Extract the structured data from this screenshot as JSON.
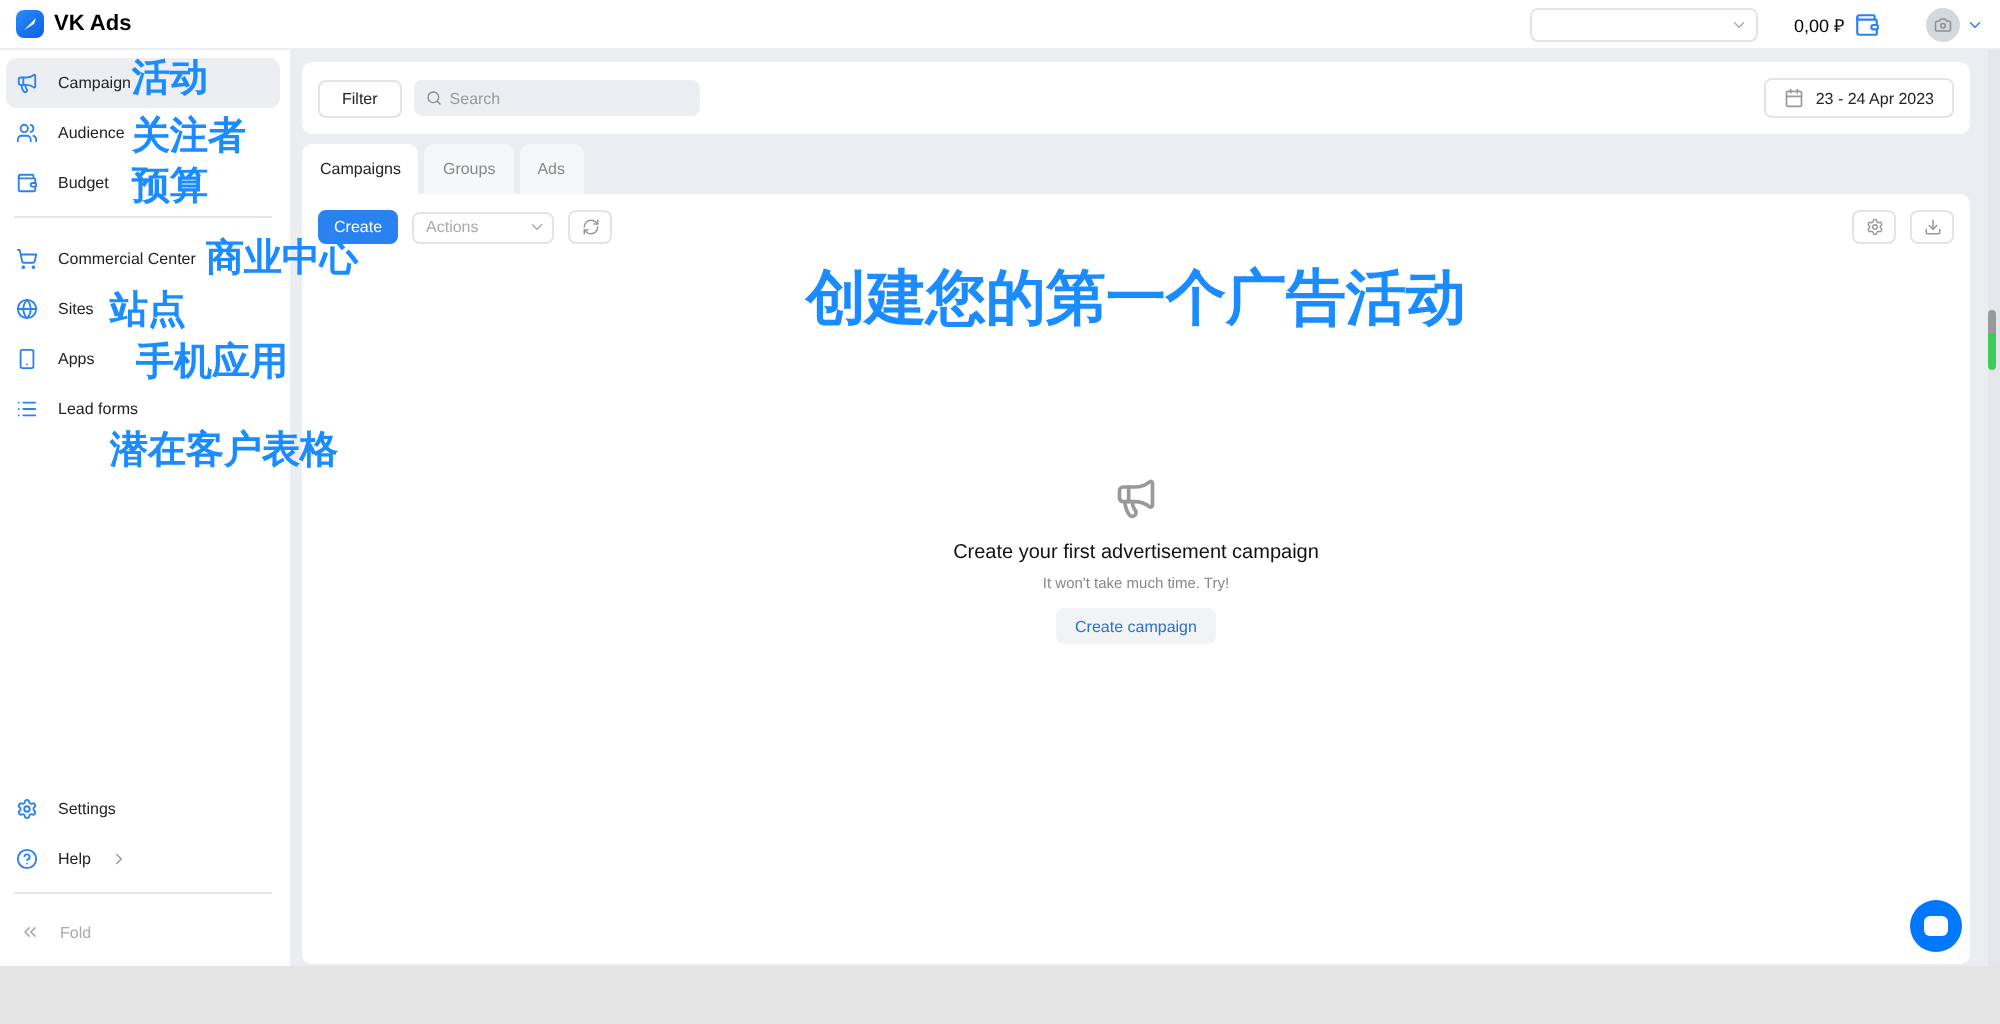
{
  "app": {
    "title": "VK Ads"
  },
  "topbar": {
    "balance": "0,00 ₽"
  },
  "sidebar": {
    "items": [
      {
        "label": "Campaign",
        "selected": true,
        "annotation": "活动"
      },
      {
        "label": "Audience",
        "selected": false,
        "annotation": "关注者"
      },
      {
        "label": "Budget",
        "selected": false,
        "annotation": "预算"
      },
      {
        "kind": "divider"
      },
      {
        "label": "Commercial Center",
        "selected": false,
        "annotation": "商业中心"
      },
      {
        "label": "Sites",
        "selected": false,
        "annotation": "站点"
      },
      {
        "label": "Apps",
        "selected": false,
        "annotation": "手机应用"
      },
      {
        "label": "Lead forms",
        "selected": false,
        "annotation": "潜在客户表格"
      }
    ],
    "bottom": [
      {
        "label": "Settings"
      },
      {
        "label": "Help"
      }
    ],
    "fold": "Fold"
  },
  "filters": {
    "filter_button": "Filter",
    "search": {
      "placeholder": "Search"
    },
    "date_range": "23 - 24 Apr 2023"
  },
  "tabs": [
    {
      "label": "Campaigns",
      "selected": true
    },
    {
      "label": "Groups",
      "selected": false
    },
    {
      "label": "Ads",
      "selected": false
    }
  ],
  "toolbar": {
    "create": "Create",
    "actions": {
      "placeholder": "Actions"
    }
  },
  "empty_state": {
    "annotation": "创建您的第一个广告活动",
    "title": "Create your first advertisement campaign",
    "subtitle": "It won't take much time. Try!",
    "button": "Create campaign"
  }
}
